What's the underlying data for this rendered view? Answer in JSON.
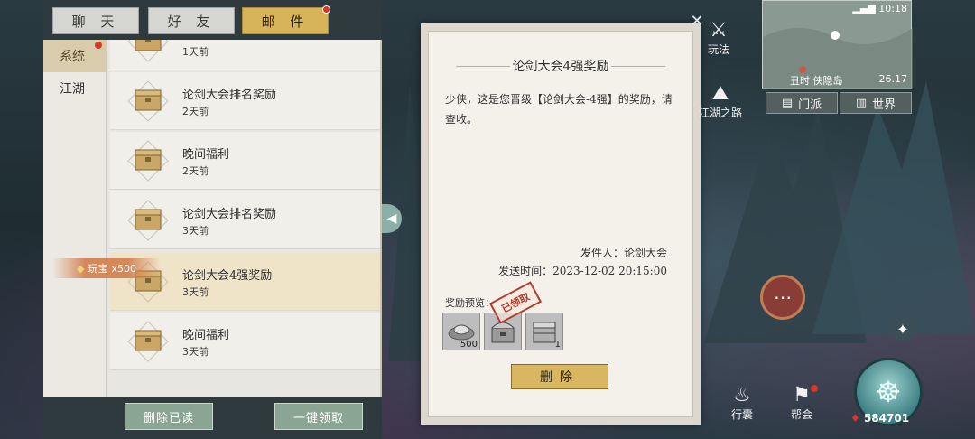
{
  "tabs": [
    {
      "label": "聊 天",
      "active": false
    },
    {
      "label": "好 友",
      "active": false
    },
    {
      "label": "邮 件",
      "active": true,
      "badge": true
    }
  ],
  "categories": [
    {
      "label": "系统",
      "active": true,
      "badge": true
    },
    {
      "label": "江湖",
      "active": false
    }
  ],
  "mails": [
    {
      "title": "",
      "time": "1天前",
      "selected": false
    },
    {
      "title": "论剑大会排名奖励",
      "time": "2天前",
      "selected": false
    },
    {
      "title": "晚间福利",
      "time": "2天前",
      "selected": false
    },
    {
      "title": "论剑大会排名奖励",
      "time": "3天前",
      "selected": false
    },
    {
      "title": "论剑大会4强奖励",
      "time": "3天前",
      "selected": true
    },
    {
      "title": "晚间福利",
      "time": "3天前",
      "selected": false
    }
  ],
  "reward_toast": {
    "label": "玩宝",
    "amount": "x500"
  },
  "bottom_buttons": {
    "delete_read": "删除已读",
    "claim_all": "一键领取"
  },
  "letter": {
    "title": "论剑大会4强奖励",
    "body": "少侠，这是您晋级【论剑大会-4强】的奖励，请查收。",
    "sender": "发件人：论剑大会",
    "sent_time": "发送时间：2023-12-02 20:15:00",
    "reward_label": "奖励预览：",
    "stamp": "已领取",
    "items": [
      {
        "icon": "ingot-icon",
        "qty": "500"
      },
      {
        "icon": "treasure-chest-icon",
        "qty": ""
      },
      {
        "icon": "silver-chest-icon",
        "qty": "1"
      }
    ],
    "delete_label": "删除"
  },
  "hud": {
    "clock": "10:18",
    "map_location": "丑时  侠隐岛",
    "map_coord": "26.17",
    "sect_btn": "门派",
    "world_btn": "世界",
    "play_label": "玩法",
    "path_label": "江湖之路",
    "bag_label": "行囊",
    "guild_label": "帮会",
    "power": "584701"
  },
  "colors": {
    "accent_gold": "#d9b660",
    "tab_active": "#d7b45a",
    "green_button": "#8aa592",
    "badge_red": "#d4382a"
  }
}
